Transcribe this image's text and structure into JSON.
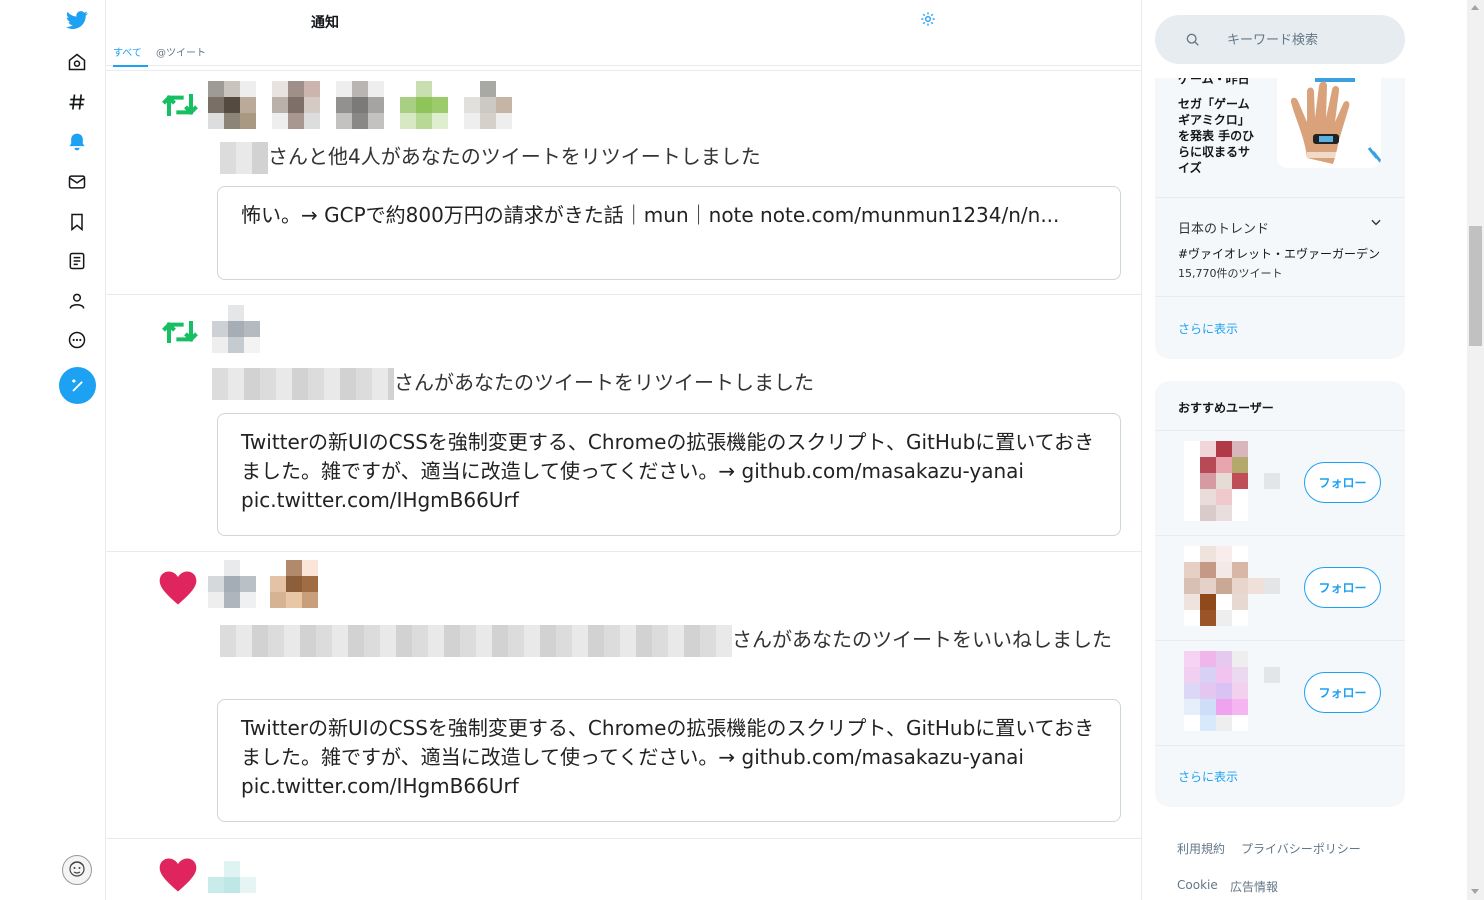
{
  "header": {
    "title": "通知",
    "tabs": [
      {
        "label": "すべて",
        "active": true
      },
      {
        "label": "@ツイート",
        "active": false
      }
    ]
  },
  "nav": {
    "icons": [
      "twitter-logo",
      "home-icon",
      "explore-hash-icon",
      "notifications-bell-icon",
      "messages-icon",
      "bookmarks-icon",
      "lists-icon",
      "profile-icon",
      "more-icon",
      "compose-tweet-icon"
    ]
  },
  "notifications": [
    {
      "type": "retweet",
      "text": "さんと他4人があなたのツイートをリツイートしました",
      "quote": "怖い。→ GCPで約800万円の請求がきた話｜mun｜note note.com/munmun1234/n/n..."
    },
    {
      "type": "retweet",
      "text": "さんがあなたのツイートをリツイートしました",
      "quote": "Twitterの新UIのCSSを強制変更する、Chromeの拡張機能のスクリプト、GitHubに置いておきました。雑ですが、適当に改造して使ってください。→ github.com/masakazu-yanai pic.twitter.com/IHgmB66Urf"
    },
    {
      "type": "like",
      "text": "さんがあなたのツイートをいいねしました",
      "quote": "Twitterの新UIのCSSを強制変更する、Chromeの拡張機能のスクリプト、GitHubに置いておきました。雑ですが、適当に改造して使ってください。→ github.com/masakazu-yanai pic.twitter.com/IHgmB66Urf"
    },
    {
      "type": "like"
    }
  ],
  "search": {
    "placeholder": "キーワード検索"
  },
  "trends": {
    "news_cut_text": "ゲーム・昨日",
    "news_text": "セガ「ゲームギアミクロ」を発表 手のひらに収まるサイズ",
    "heading": "日本のトレンド",
    "tag": "#ヴァイオレット・エヴァーガーデン",
    "count": "15,770件のツイート",
    "show_more": "さらに表示"
  },
  "who_to_follow": {
    "title": "おすすめユーザー",
    "follow_label": "フォロー",
    "show_more": "さらに表示"
  },
  "footer": {
    "links": [
      "利用規約",
      "プライバシーポリシー",
      "Cookie",
      "広告情報"
    ]
  },
  "colors": {
    "accent": "#1da1f2",
    "retweet": "#17bf63",
    "like": "#e0245e"
  }
}
